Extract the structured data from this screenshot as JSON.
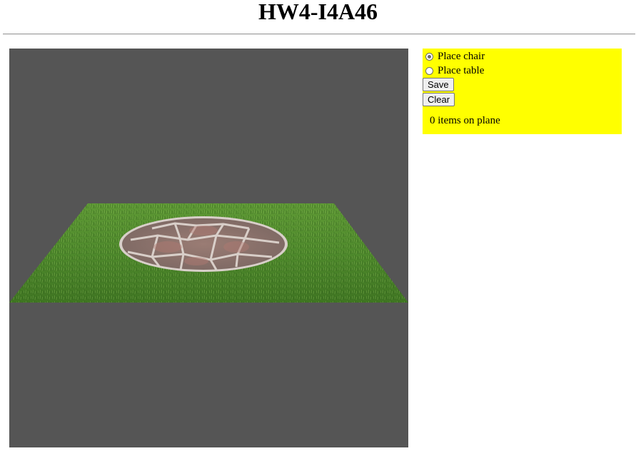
{
  "header": {
    "title": "HW4-I4A46"
  },
  "controls": {
    "options": [
      {
        "label": "Place chair",
        "checked": true
      },
      {
        "label": "Place table",
        "checked": false
      }
    ],
    "save_label": "Save",
    "clear_label": "Clear",
    "status_text": "0 items on plane"
  },
  "colors": {
    "canvas_background": "#555555",
    "panel_background": "#ffff00",
    "grass": "#4f8a2c",
    "stone_patio": "#8a716a"
  }
}
